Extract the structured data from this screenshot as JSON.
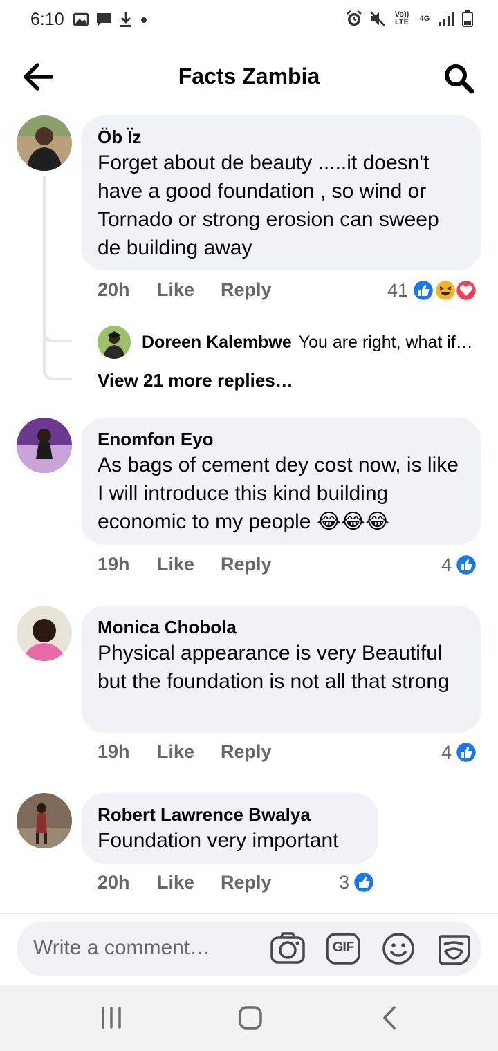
{
  "status_bar": {
    "time": "6:10",
    "volte": "Vo)) LTE",
    "network": "4G"
  },
  "header": {
    "title": "Facts Zambia"
  },
  "comments": [
    {
      "author": "Öb Ïz",
      "text": "Forget about de beauty .....it doesn't have a good foundation , so wind or Tornado or strong erosion can sweep de building away",
      "time": "20h",
      "like": "Like",
      "reply": "Reply",
      "reactions": "41"
    },
    {
      "author": "Enomfon Eyo",
      "text": "As bags of cement dey cost now, is like I will introduce this kind building economic to my people",
      "emoji": "😂😂😂",
      "time": "19h",
      "like": "Like",
      "reply": "Reply",
      "reactions": "4"
    },
    {
      "author": "Monica Chobola",
      "text": "Physical appearance is very Beautiful but the foundation is not all that strong",
      "time": "19h",
      "like": "Like",
      "reply": "Reply",
      "reactions": "4"
    },
    {
      "author": "Robert Lawrence Bwalya",
      "text": "Foundation very important",
      "time": "20h",
      "like": "Like",
      "reply": "Reply",
      "reactions": "3"
    }
  ],
  "reply_preview": {
    "author": "Doreen Kalembwe",
    "text": "You are right, what if…"
  },
  "view_more": "View 21 more replies…",
  "composer": {
    "placeholder": "Write a comment…",
    "gif_label": "GIF"
  },
  "colors": {
    "like_blue": "#1877f2",
    "love_red": "#f33e58",
    "haha_yellow": "#f7b125",
    "bubble_bg": "#f0f2f5",
    "secondary_text": "#65676b"
  }
}
